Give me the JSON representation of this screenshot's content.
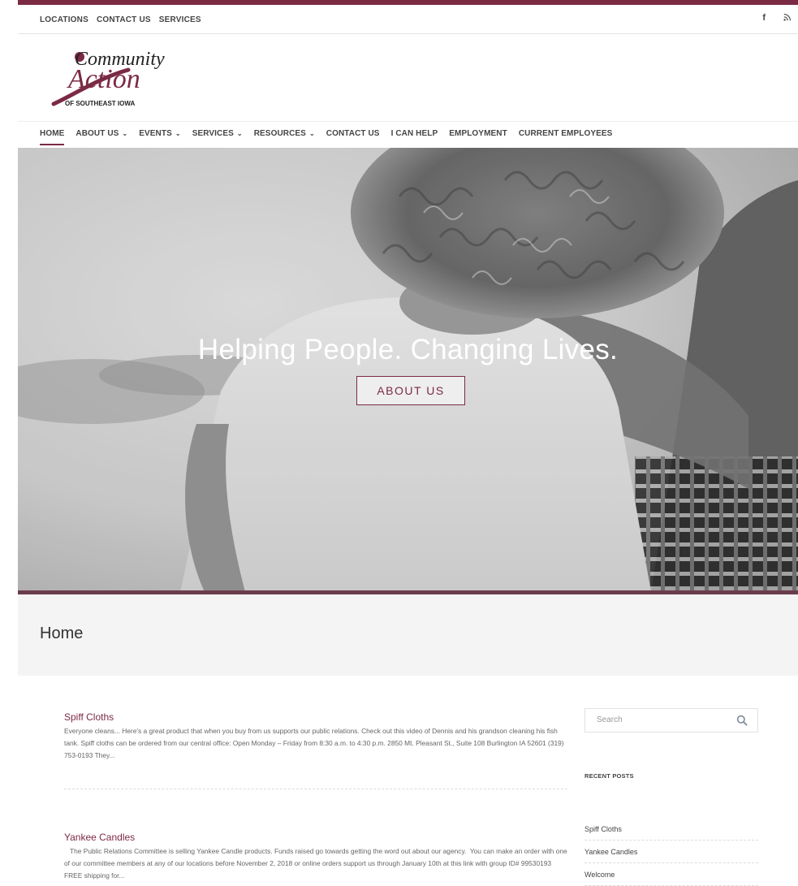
{
  "topbar": {
    "links": [
      "LOCATIONS",
      "CONTACT US",
      "SERVICES"
    ],
    "social": [
      {
        "icon": "facebook-icon",
        "glyph": "f"
      },
      {
        "icon": "rss-icon",
        "glyph": "Ω"
      }
    ]
  },
  "logo": {
    "line1": "Community",
    "line2": "Action",
    "line3": "OF SOUTHEAST IOWA"
  },
  "nav": [
    {
      "label": "HOME",
      "chev": false,
      "active": true
    },
    {
      "label": "ABOUT US",
      "chev": true,
      "active": false
    },
    {
      "label": "EVENTS",
      "chev": true,
      "active": false
    },
    {
      "label": "SERVICES",
      "chev": true,
      "active": false
    },
    {
      "label": "RESOURCES",
      "chev": true,
      "active": false
    },
    {
      "label": "CONTACT US",
      "chev": false,
      "active": false
    },
    {
      "label": "I CAN HELP",
      "chev": false,
      "active": false
    },
    {
      "label": "EMPLOYMENT",
      "chev": false,
      "active": false
    },
    {
      "label": "CURRENT EMPLOYEES",
      "chev": false,
      "active": false
    }
  ],
  "hero": {
    "title": "Helping People. Changing Lives.",
    "button": "ABOUT US"
  },
  "page": {
    "title": "Home"
  },
  "posts": [
    {
      "title": "Spiff Cloths",
      "excerpt": "Everyone cleans... Here's a great product that when you buy from us supports our public relations. Check out this video of Dennis and his grandson cleaning his fish tank. Spiff cloths can be ordered from our central office: Open Monday – Friday from 8:30 a.m. to 4:30 p.m. 2850 Mt. Pleasant St., Suite 108 Burlington IA 52601 (319) 753-0193 They..."
    },
    {
      "title": "Yankee Candles",
      "excerpt": "   The Public Relations Committee is selling Yankee Candle products. Funds raised go towards getting the word out about our agency.  You can make an order with one of our committee members at any of our locations before November 2, 2018 or online orders support us through January 10th at this link with group ID# 99530193 FREE shipping for..."
    }
  ],
  "sidebar": {
    "search_placeholder": "Search",
    "recent_heading": "RECENT POSTS",
    "recent": [
      "Spiff Cloths",
      "Yankee Candles",
      "Welcome"
    ]
  },
  "colors": {
    "brand": "#7b2a44"
  }
}
